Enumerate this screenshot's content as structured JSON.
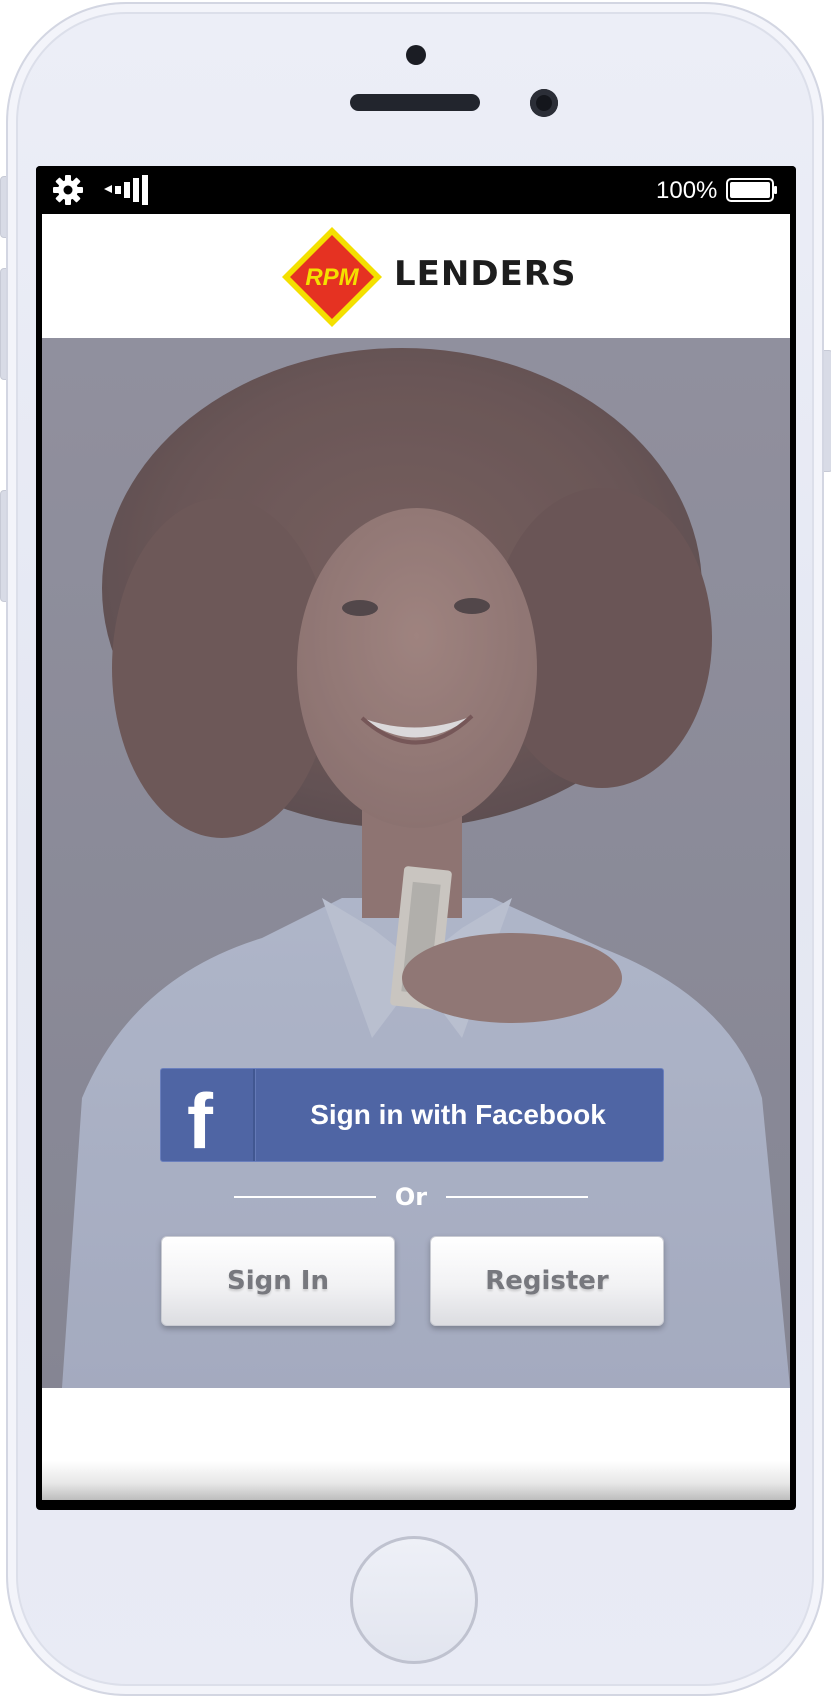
{
  "status_bar": {
    "battery_percent": "100%",
    "left_icons": [
      "gear-icon",
      "signal-icon"
    ],
    "right_icons": [
      "battery-icon"
    ]
  },
  "header": {
    "logo_text": "RPM",
    "brand_name": "LENDERS",
    "logo_colors": {
      "outer": "#f4e000",
      "inner": "#e53222"
    }
  },
  "auth": {
    "facebook_label": "Sign in with Facebook",
    "facebook_icon": "f",
    "divider_text": "Or",
    "signin_label": "Sign In",
    "register_label": "Register"
  },
  "colors": {
    "facebook_blue": "#4f65a4",
    "status_bar": "#000000",
    "header_bg": "#ffffff",
    "button_text": "#77787e"
  }
}
